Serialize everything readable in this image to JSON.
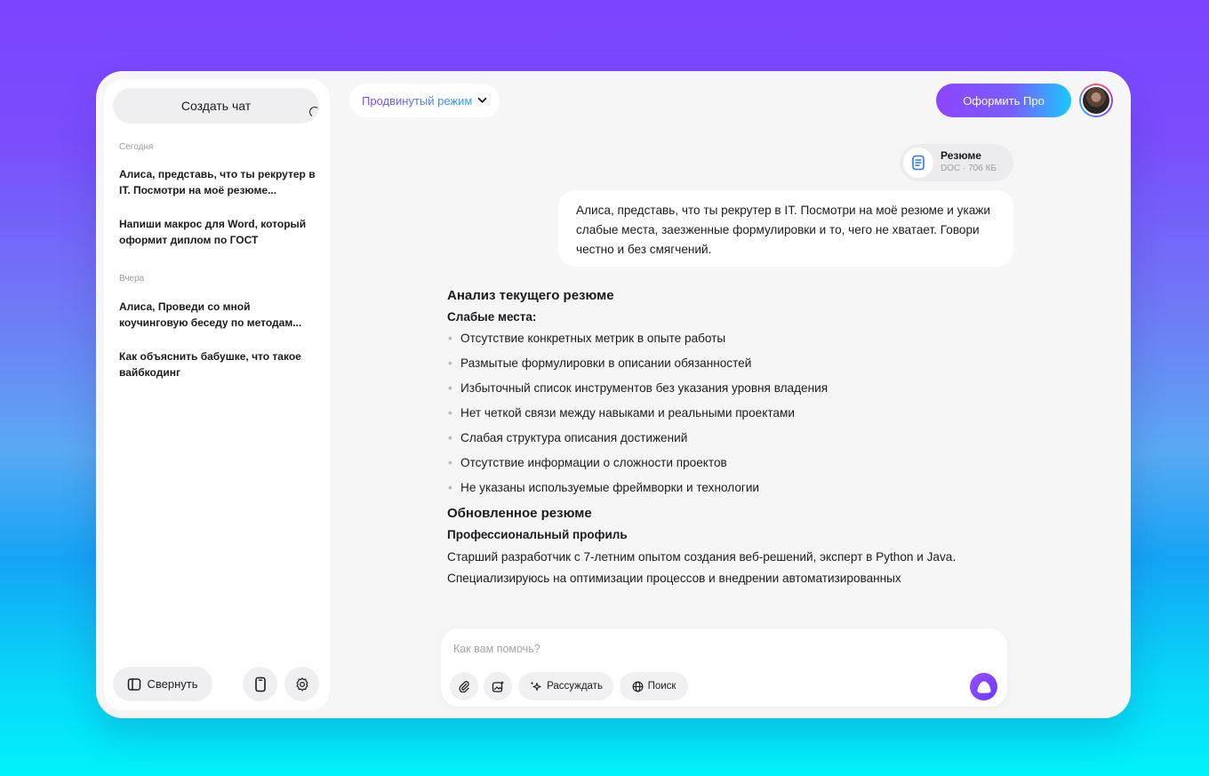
{
  "sidebar": {
    "new_chat_label": "Создать чат",
    "groups": [
      {
        "label": "Сегодня",
        "items": [
          "Алиса, представь, что ты рекрутер в IT. Посмотри на моё резюме...",
          "Напиши макрос для Word, который оформит диплом по ГОСТ"
        ]
      },
      {
        "label": "Вчера",
        "items": [
          "Алиса, Проведи со мной коучинговую беседу по методам...",
          "Как объяснить бабушке, что такое вайбкодинг"
        ]
      }
    ],
    "collapse_label": "Свернуть",
    "icons": {
      "collapse": "sidebar-panel-icon",
      "device": "phone-icon",
      "settings": "gear-icon"
    }
  },
  "header": {
    "mode_label": "Продвинутый режим",
    "mode_icon": "chevron-down-icon",
    "pro_label": "Оформить Про"
  },
  "chat": {
    "attachment": {
      "name": "Резюме",
      "meta": "DOC · 706 КБ",
      "icon": "document-icon"
    },
    "user_message": "Алиса, представь, что ты рекрутер в IT. Посмотри на моё резюме и укажи слабые места, заезженные формулировки и то, чего не хватает. Говори честно и без смягчений.",
    "answer": {
      "heading1": "Анализ текущего резюме",
      "subheading1": "Слабые места:",
      "bullets": [
        "Отсутствие конкретных метрик в опыте работы",
        "Размытые формулировки в описании обязанностей",
        "Избыточный список инструментов без указания уровня владения",
        "Нет четкой связи между навыками и реальными проектами",
        "Слабая структура описания достижений",
        "Отсутствие информации о сложности проектов",
        "Не указаны используемые фреймворки и технологии"
      ],
      "heading2": "Обновленное резюме",
      "subheading2": "Профессиональный профиль",
      "paragraph": "Старший разработчик с 7-летним опытом создания веб-решений, эксперт в Python и Java. Специализируюсь на оптимизации процессов и внедрении автоматизированных"
    }
  },
  "composer": {
    "placeholder": "Как вам помочь?",
    "reason_label": "Рассуждать",
    "search_label": "Поиск",
    "icons": {
      "attach": "paperclip-icon",
      "image": "image-sparkle-icon",
      "reason": "sparkle-icon",
      "search": "globe-icon",
      "send": "alice-send-icon"
    }
  },
  "colors": {
    "accent": "#7a4dff",
    "pro_gradient_end": "#19c9ff"
  }
}
